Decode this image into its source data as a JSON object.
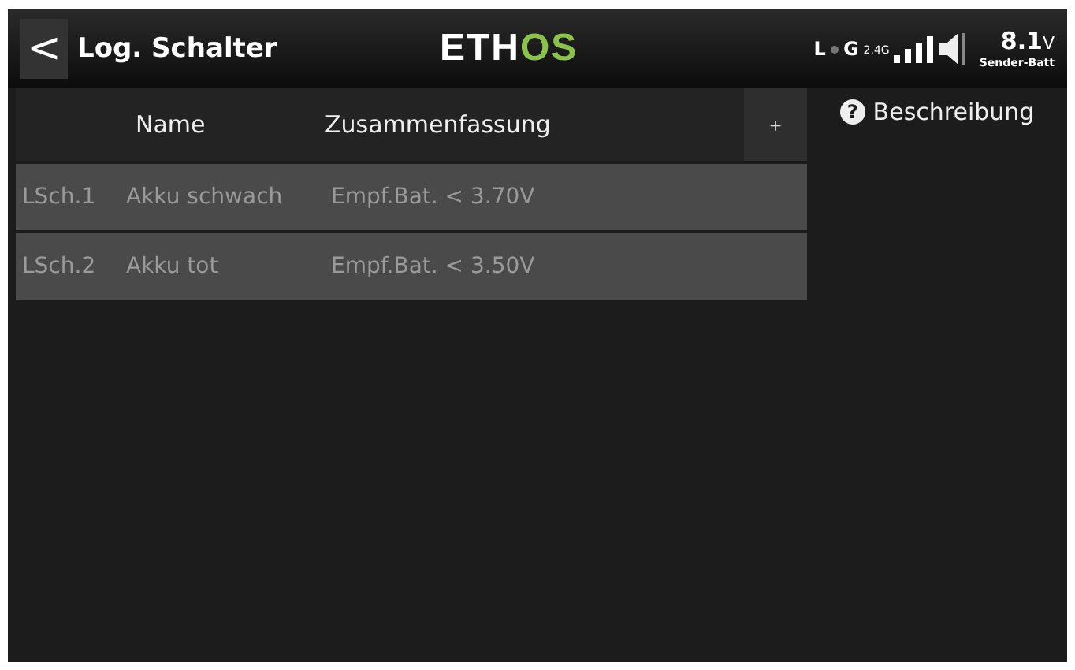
{
  "header": {
    "back": "<",
    "title": "Log. Schalter",
    "logo": [
      {
        "text": "ETH",
        "accent": false
      },
      {
        "text": "OS",
        "accent": true
      }
    ],
    "status": {
      "l": "L",
      "g": "G",
      "band": "2.4G",
      "voltage": "8.1",
      "unit": "V",
      "label": "Sender-Batt"
    }
  },
  "table": {
    "columns": [
      "Name",
      "Zusammenfassung"
    ],
    "add": "+",
    "rows": [
      {
        "id": "LSch.1",
        "name": "Akku schwach",
        "summary": "Empf.Bat. < 3.70V"
      },
      {
        "id": "LSch.2",
        "name": "Akku tot",
        "summary": "Empf.Bat. < 3.50V"
      }
    ]
  },
  "help": {
    "icon": "?",
    "label": "Beschreibung"
  }
}
